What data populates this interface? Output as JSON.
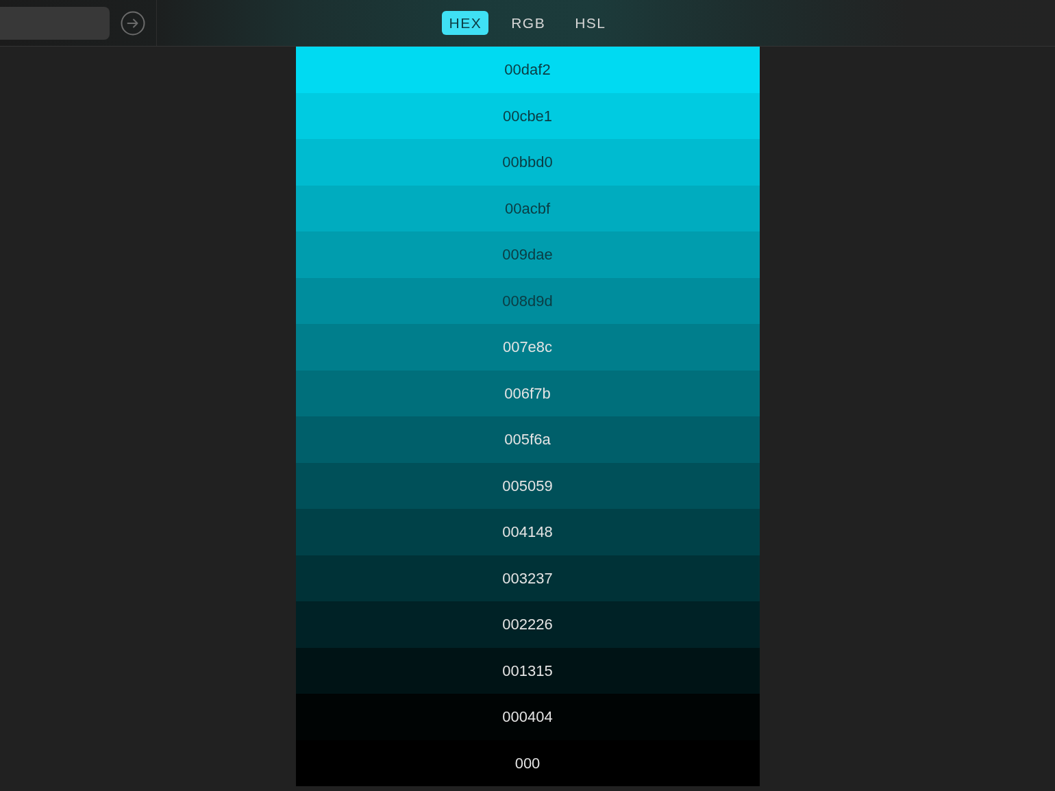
{
  "format_tabs": [
    {
      "label": "HEX",
      "selected": true
    },
    {
      "label": "RGB",
      "selected": false
    },
    {
      "label": "HSL",
      "selected": false
    }
  ],
  "swatches": [
    {
      "label": "00daf2",
      "color": "#00daf2"
    },
    {
      "label": "00cbe1",
      "color": "#00cbe1"
    },
    {
      "label": "00bbd0",
      "color": "#00bbd0"
    },
    {
      "label": "00acbf",
      "color": "#00acbf"
    },
    {
      "label": "009dae",
      "color": "#009dae"
    },
    {
      "label": "008d9d",
      "color": "#008d9d"
    },
    {
      "label": "007e8c",
      "color": "#007e8c"
    },
    {
      "label": "006f7b",
      "color": "#006f7b"
    },
    {
      "label": "005f6a",
      "color": "#005f6a"
    },
    {
      "label": "005059",
      "color": "#005059"
    },
    {
      "label": "004148",
      "color": "#004148"
    },
    {
      "label": "003237",
      "color": "#003237"
    },
    {
      "label": "002226",
      "color": "#002226"
    },
    {
      "label": "001315",
      "color": "#001315"
    },
    {
      "label": "000404",
      "color": "#000404"
    },
    {
      "label": "000",
      "color": "#000000"
    }
  ]
}
